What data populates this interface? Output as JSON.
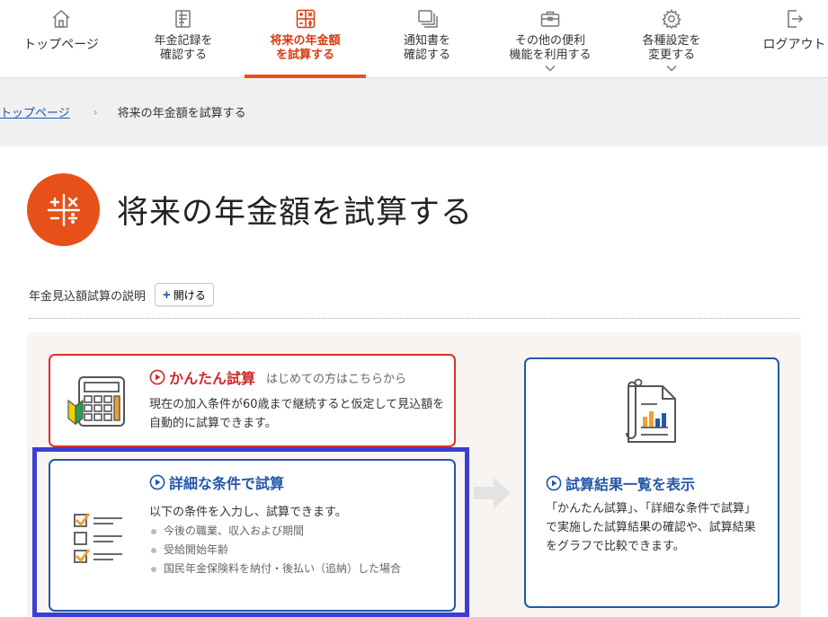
{
  "nav": [
    {
      "label": "トップページ",
      "icon": "home-icon",
      "chevron": false,
      "active": false
    },
    {
      "label": "年金記録を\n確認する",
      "icon": "record-icon",
      "chevron": false,
      "active": false
    },
    {
      "label": "将来の年金額\nを試算する",
      "icon": "calculator-icon",
      "chevron": false,
      "active": true
    },
    {
      "label": "通知書を\n確認する",
      "icon": "documents-icon",
      "chevron": false,
      "active": false
    },
    {
      "label": "その他の便利\n機能を利用する",
      "icon": "toolbox-icon",
      "chevron": true,
      "active": false
    },
    {
      "label": "各種設定を\n変更する",
      "icon": "gear-icon",
      "chevron": true,
      "active": false
    },
    {
      "label": "ログアウト",
      "icon": "logout-icon",
      "chevron": false,
      "active": false
    }
  ],
  "breadcrumb": {
    "home": "トップページ",
    "separator": "›",
    "current": "将来の年金額を試算する"
  },
  "page": {
    "title": "将来の年金額を試算する"
  },
  "explain": {
    "label": "年金見込額試算の説明",
    "button_plus": "+",
    "button_label": "開ける"
  },
  "easy": {
    "title": "かんたん試算",
    "subtitle": "はじめての方はこちらから",
    "desc": "現在の加入条件が60歳まで継続すると仮定して見込額を自動的に試算できます。"
  },
  "detail": {
    "title": "詳細な条件で試算",
    "desc": "以下の条件を入力し、試算できます。",
    "items": [
      "今後の職業、収入および期間",
      "受給開始年齢",
      "国民年金保険料を納付・後払い（追納）した場合"
    ]
  },
  "results": {
    "title": "試算結果一覧を表示",
    "desc": "「かんたん試算」、「詳細な条件で試算」で実施した試算結果の確認や、試算結果をグラフで比較できます。"
  },
  "colors": {
    "accent": "#e8501a",
    "red": "#cf2a28",
    "blue": "#2457a8",
    "focus": "#3a3fd0"
  }
}
